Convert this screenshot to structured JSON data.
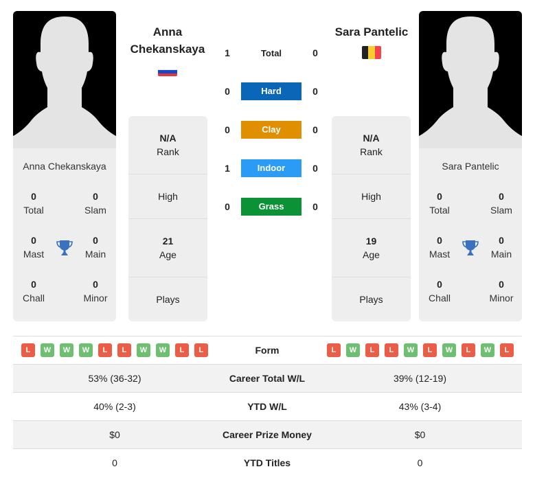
{
  "colors": {
    "hard": "#0a67b8",
    "clay": "#e08f00",
    "indoor": "#2a9cf6",
    "grass": "#0b9136",
    "win": "#6fbf73",
    "loss": "#ec5d47",
    "trophy": "#3a72bf"
  },
  "player1": {
    "name": "Anna Chekanskaya",
    "name_line1": "Anna",
    "name_line2": "Chekanskaya",
    "flag": "russia-flag",
    "titles": {
      "total": {
        "value": "0",
        "label": "Total"
      },
      "slam": {
        "value": "0",
        "label": "Slam"
      },
      "mast": {
        "value": "0",
        "label": "Mast"
      },
      "main": {
        "value": "0",
        "label": "Main"
      },
      "chall": {
        "value": "0",
        "label": "Chall"
      },
      "minor": {
        "value": "0",
        "label": "Minor"
      }
    },
    "info": {
      "rank": {
        "value": "N/A",
        "label": "Rank"
      },
      "high": {
        "label": "High"
      },
      "age": {
        "value": "21",
        "label": "Age"
      },
      "plays": {
        "label": "Plays"
      }
    },
    "form": [
      "L",
      "W",
      "W",
      "W",
      "L",
      "L",
      "W",
      "W",
      "L",
      "L"
    ]
  },
  "player2": {
    "name": "Sara Pantelic",
    "flag": "belgium-flag",
    "titles": {
      "total": {
        "value": "0",
        "label": "Total"
      },
      "slam": {
        "value": "0",
        "label": "Slam"
      },
      "mast": {
        "value": "0",
        "label": "Mast"
      },
      "main": {
        "value": "0",
        "label": "Main"
      },
      "chall": {
        "value": "0",
        "label": "Chall"
      },
      "minor": {
        "value": "0",
        "label": "Minor"
      }
    },
    "info": {
      "rank": {
        "value": "N/A",
        "label": "Rank"
      },
      "high": {
        "label": "High"
      },
      "age": {
        "value": "19",
        "label": "Age"
      },
      "plays": {
        "label": "Plays"
      }
    },
    "form": [
      "L",
      "W",
      "L",
      "L",
      "W",
      "L",
      "W",
      "L",
      "W",
      "L"
    ]
  },
  "h2h": [
    {
      "label": "Total",
      "p1": "1",
      "p2": "0",
      "key": "total"
    },
    {
      "label": "Hard",
      "p1": "0",
      "p2": "0",
      "key": "hard"
    },
    {
      "label": "Clay",
      "p1": "0",
      "p2": "0",
      "key": "clay"
    },
    {
      "label": "Indoor",
      "p1": "1",
      "p2": "0",
      "key": "indoor"
    },
    {
      "label": "Grass",
      "p1": "0",
      "p2": "0",
      "key": "grass"
    }
  ],
  "stats": {
    "form_label": "Form",
    "rows": [
      {
        "label": "Career Total W/L",
        "p1": "53% (36-32)",
        "p2": "39% (12-19)"
      },
      {
        "label": "YTD W/L",
        "p1": "40% (2-3)",
        "p2": "43% (3-4)"
      },
      {
        "label": "Career Prize Money",
        "p1": "$0",
        "p2": "$0"
      },
      {
        "label": "YTD Titles",
        "p1": "0",
        "p2": "0"
      }
    ]
  }
}
